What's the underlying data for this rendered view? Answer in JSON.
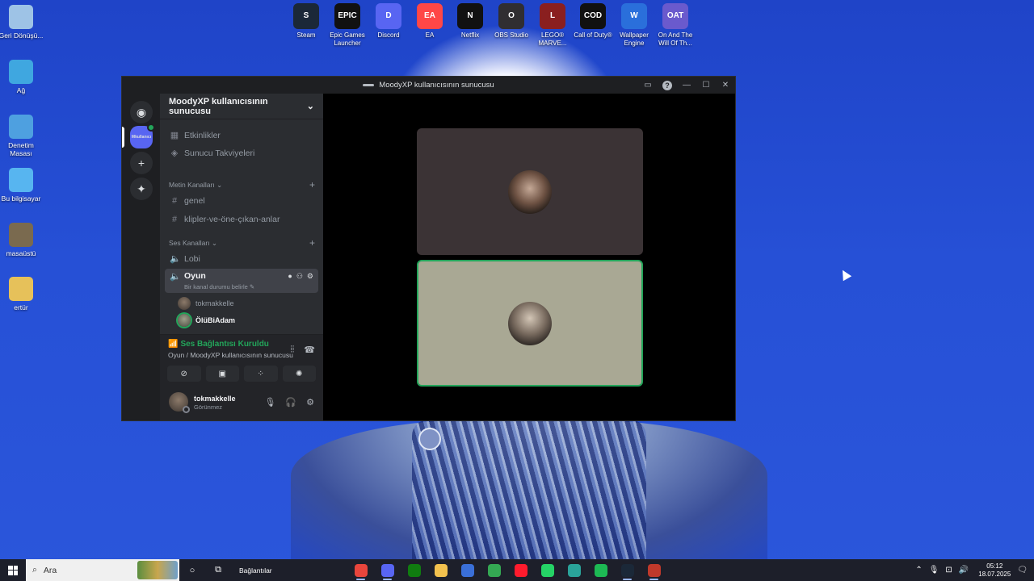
{
  "desktop": {
    "left_icons": [
      {
        "label": "Geri Dönüşü...",
        "icon": "recycle-bin-icon",
        "color": "#9ec3e6"
      },
      {
        "label": "Ağ",
        "icon": "network-icon",
        "color": "#3fa7e0"
      },
      {
        "label": "Denetim Masası",
        "icon": "control-panel-icon",
        "color": "#4ea0e0"
      },
      {
        "label": "Bu bilgisayar",
        "icon": "this-pc-icon",
        "color": "#57b5f0"
      },
      {
        "label": "masaüstü",
        "icon": "folder-icon",
        "color": "#7a6a4f"
      },
      {
        "label": "ertür",
        "icon": "folder-user-icon",
        "color": "#e6c15a"
      }
    ],
    "top_icons": [
      {
        "label": "Steam",
        "icon": "steam-icon",
        "color": "#1b2838",
        "glyph": "S"
      },
      {
        "label": "Epic Games Launcher",
        "icon": "epic-games-icon",
        "color": "#111111",
        "glyph": "EPIC"
      },
      {
        "label": "Discord",
        "icon": "discord-icon",
        "color": "#5865f2",
        "glyph": "D"
      },
      {
        "label": "EA",
        "icon": "ea-icon",
        "color": "#ff4747",
        "glyph": "EA"
      },
      {
        "label": "Netflix",
        "icon": "netflix-icon",
        "color": "#111111",
        "glyph": "N"
      },
      {
        "label": "OBS Studio",
        "icon": "obs-icon",
        "color": "#302e31",
        "glyph": "O"
      },
      {
        "label": "LEGO® MARVE...",
        "icon": "lego-marvel-icon",
        "color": "#8a1f1f",
        "glyph": "L"
      },
      {
        "label": "Call of Duty®",
        "icon": "call-of-duty-icon",
        "color": "#111111",
        "glyph": "COD"
      },
      {
        "label": "Wallpaper Engine",
        "icon": "wallpaper-engine-icon",
        "color": "#2a6fdb",
        "glyph": "W"
      },
      {
        "label": "On And The Will Of Th...",
        "icon": "game-icon",
        "color": "#6a5acd",
        "glyph": "OAT"
      }
    ]
  },
  "window": {
    "title": "MoodyXP kullanıcısının sunucusu"
  },
  "rail": {
    "server_abbr": "Mkullanıcı"
  },
  "sidebar": {
    "server_name": "MoodyXP kullanıcısının sunucusu",
    "top_items": [
      {
        "label": "Etkinlikler",
        "icon": "calendar-icon"
      },
      {
        "label": "Sunucu Takviyeleri",
        "icon": "boost-icon"
      }
    ],
    "text_category": "Metin Kanalları",
    "text_channels": [
      "genel",
      "klipler-ve-öne-çıkan-anlar"
    ],
    "voice_category": "Ses Kanalları",
    "voice_channels": [
      {
        "label": "Lobi"
      },
      {
        "label": "Oyun",
        "sub": "Bir kanal durumu belirle"
      }
    ],
    "voice_users": [
      {
        "name": "tokmakkelle"
      },
      {
        "name": "ÖlüBiAdam"
      }
    ]
  },
  "voice_panel": {
    "title": "Ses Bağlantısı Kuruldu",
    "subtitle": "Oyun / MoodyXP kullanıcısının sunucusu"
  },
  "user_panel": {
    "name": "tokmakkelle",
    "status": "Görünmez"
  },
  "taskbar": {
    "search_placeholder": "Ara",
    "links_label": "Bağlantılar",
    "time": "05:12",
    "date": "18.07.2025",
    "apps": [
      {
        "icon": "chrome-icon",
        "color": "#e8453c",
        "active": true
      },
      {
        "icon": "discord-icon",
        "color": "#5865f2",
        "active": true
      },
      {
        "icon": "xbox-icon",
        "color": "#107c10",
        "active": false
      },
      {
        "icon": "file-explorer-icon",
        "color": "#f2c14e",
        "active": false
      },
      {
        "icon": "calculator-icon",
        "color": "#3a6fd8",
        "active": false
      },
      {
        "icon": "chrome-icon",
        "color": "#34a853",
        "active": false
      },
      {
        "icon": "opera-icon",
        "color": "#ff1b2d",
        "active": false
      },
      {
        "icon": "whatsapp-icon",
        "color": "#25d366",
        "active": false
      },
      {
        "icon": "app-icon",
        "color": "#2aa39a",
        "active": false
      },
      {
        "icon": "spotify-icon",
        "color": "#1db954",
        "active": false
      },
      {
        "icon": "steam-icon",
        "color": "#1b2838",
        "active": true
      },
      {
        "icon": "obs-icon",
        "color": "#c0392b",
        "active": true
      }
    ]
  }
}
